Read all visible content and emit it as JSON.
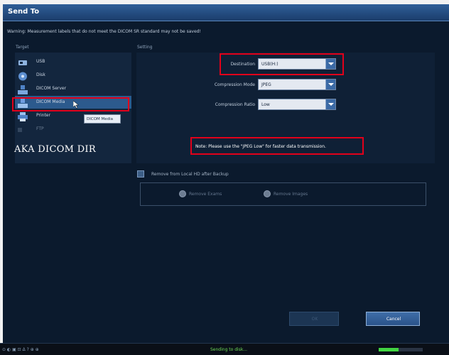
{
  "window": {
    "title": "Send To"
  },
  "warning": "Warning: Measurement labels that do not meet the DICOM SR standard may not be saved!",
  "target": {
    "section_label": "Target",
    "items": [
      {
        "label": "USB",
        "icon": "usb-icon"
      },
      {
        "label": "Disk",
        "icon": "disk-icon"
      },
      {
        "label": "DICOM Server",
        "icon": "dicom-server-icon"
      },
      {
        "label": "DICOM Media",
        "icon": "dicom-media-icon",
        "selected": true
      },
      {
        "label": "Printer",
        "icon": "printer-icon"
      },
      {
        "label": "FTP",
        "icon": "ftp-icon"
      }
    ],
    "tooltip": "DICOM Media",
    "annotation": "AKA DICOM DIR"
  },
  "setting": {
    "section_label": "Setting",
    "destination": {
      "label": "Destination",
      "value": "USB(H:)"
    },
    "compression_mode": {
      "label": "Compression Mode",
      "value": "JPEG"
    },
    "compression_ratio": {
      "label": "Compression Ratio",
      "value": "Low"
    },
    "note": "Note: Please use the \"JPEG Low\" for faster data transmission."
  },
  "remove": {
    "checkbox_label": "Remove from Local HD after Backup",
    "options": [
      "Remove Exams",
      "Remove Images"
    ]
  },
  "buttons": {
    "ok": "OK",
    "cancel": "Cancel"
  },
  "status": {
    "icons_text": "⊙ ◐ ▣ ⊡ Δ ? ⊕ ⊕",
    "text": "Sending to disk...",
    "progress": 0.45
  },
  "colors": {
    "window_bg": "#0b1a2d",
    "title_bar": "#1b3d6b",
    "highlight": "#e2001a",
    "selected_row": "#2c5a8d",
    "status_green": "#42d642"
  }
}
